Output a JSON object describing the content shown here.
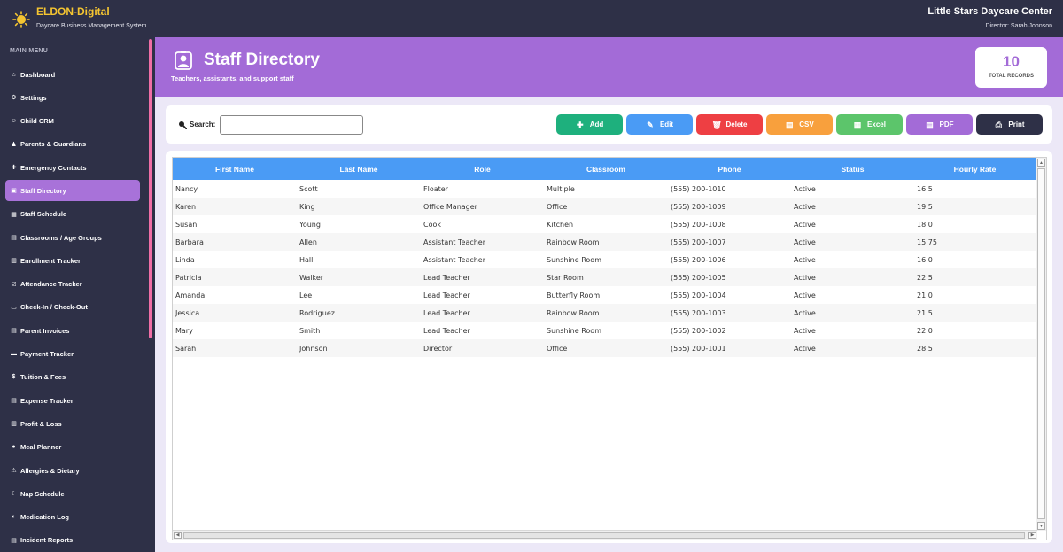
{
  "app": {
    "brand": "ELDON-Digital",
    "tagline": "Daycare Business Management System",
    "center_name": "Little Stars Daycare Center",
    "director": "Director: Sarah Johnson"
  },
  "sidebar": {
    "section_title": "MAIN MENU",
    "items": [
      {
        "label": "Dashboard",
        "icon": "home-icon"
      },
      {
        "label": "Settings",
        "icon": "gear-icon"
      },
      {
        "label": "Child CRM",
        "icon": "child-icon"
      },
      {
        "label": "Parents & Guardians",
        "icon": "users-icon"
      },
      {
        "label": "Emergency Contacts",
        "icon": "ambulance-icon"
      },
      {
        "label": "Staff Directory",
        "icon": "staff-icon",
        "active": true
      },
      {
        "label": "Staff Schedule",
        "icon": "calendar-icon"
      },
      {
        "label": "Classrooms / Age Groups",
        "icon": "classroom-icon"
      },
      {
        "label": "Enrollment Tracker",
        "icon": "clipboard-icon"
      },
      {
        "label": "Attendance Tracker",
        "icon": "checkbox-icon"
      },
      {
        "label": "Check-In / Check-Out",
        "icon": "door-icon"
      },
      {
        "label": "Parent Invoices",
        "icon": "invoice-icon"
      },
      {
        "label": "Payment Tracker",
        "icon": "card-icon"
      },
      {
        "label": "Tuition & Fees",
        "icon": "dollar-icon"
      },
      {
        "label": "Expense Tracker",
        "icon": "receipt-icon"
      },
      {
        "label": "Profit & Loss",
        "icon": "chart-icon"
      },
      {
        "label": "Meal Planner",
        "icon": "meal-icon"
      },
      {
        "label": "Allergies & Dietary",
        "icon": "warning-icon"
      },
      {
        "label": "Nap Schedule",
        "icon": "moon-icon"
      },
      {
        "label": "Medication Log",
        "icon": "pill-icon"
      },
      {
        "label": "Incident Reports",
        "icon": "report-icon"
      }
    ]
  },
  "header": {
    "title": "Staff Directory",
    "subtitle": "Teachers, assistants, and support staff",
    "records_count": "10",
    "records_label": "TOTAL RECORDS"
  },
  "toolbar": {
    "search_label": "Search:",
    "search_value": "",
    "buttons": [
      {
        "label": "Add",
        "color": "#1eb07d",
        "icon": "plus-icon"
      },
      {
        "label": "Edit",
        "color": "#4a9bf5",
        "icon": "pencil-icon"
      },
      {
        "label": "Delete",
        "color": "#ee3f43",
        "icon": "trash-icon"
      },
      {
        "label": "CSV",
        "color": "#f8a03d",
        "icon": "csv-icon"
      },
      {
        "label": "Excel",
        "color": "#5cc56b",
        "icon": "excel-icon"
      },
      {
        "label": "PDF",
        "color": "#a36bd7",
        "icon": "pdf-icon"
      },
      {
        "label": "Print",
        "color": "#2e3047",
        "icon": "printer-icon"
      }
    ]
  },
  "table": {
    "columns": [
      "First Name",
      "Last Name",
      "Role",
      "Classroom",
      "Phone",
      "Status",
      "Hourly Rate"
    ],
    "rows": [
      [
        "Nancy",
        "Scott",
        "Floater",
        "Multiple",
        "(555) 200-1010",
        "Active",
        "16.5"
      ],
      [
        "Karen",
        "King",
        "Office Manager",
        "Office",
        "(555) 200-1009",
        "Active",
        "19.5"
      ],
      [
        "Susan",
        "Young",
        "Cook",
        "Kitchen",
        "(555) 200-1008",
        "Active",
        "18.0"
      ],
      [
        "Barbara",
        "Allen",
        "Assistant Teacher",
        "Rainbow Room",
        "(555) 200-1007",
        "Active",
        "15.75"
      ],
      [
        "Linda",
        "Hall",
        "Assistant Teacher",
        "Sunshine Room",
        "(555) 200-1006",
        "Active",
        "16.0"
      ],
      [
        "Patricia",
        "Walker",
        "Lead Teacher",
        "Star Room",
        "(555) 200-1005",
        "Active",
        "22.5"
      ],
      [
        "Amanda",
        "Lee",
        "Lead Teacher",
        "Butterfly Room",
        "(555) 200-1004",
        "Active",
        "21.0"
      ],
      [
        "Jessica",
        "Rodriguez",
        "Lead Teacher",
        "Rainbow Room",
        "(555) 200-1003",
        "Active",
        "21.5"
      ],
      [
        "Mary",
        "Smith",
        "Lead Teacher",
        "Sunshine Room",
        "(555) 200-1002",
        "Active",
        "22.0"
      ],
      [
        "Sarah",
        "Johnson",
        "Director",
        "Office",
        "(555) 200-1001",
        "Active",
        "28.5"
      ]
    ]
  },
  "colors": {
    "sidebar_bg": "#2e3047",
    "accent_purple": "#a36bd7",
    "brand_yellow": "#f5c531",
    "table_header": "#4a9bf5",
    "scroll_pink": "#f06ea6"
  }
}
